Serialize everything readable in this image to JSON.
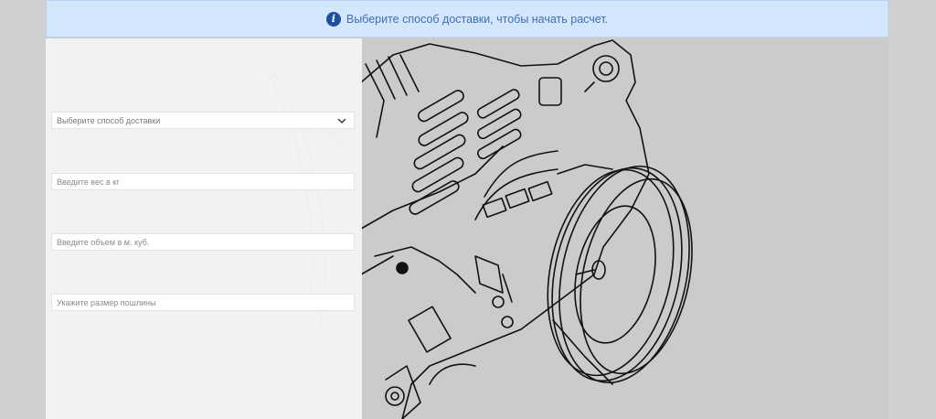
{
  "alert": {
    "icon": "info-icon",
    "icon_glyph": "i",
    "text": "Выберите способ доставки, чтобы начать расчет."
  },
  "form": {
    "delivery_select": {
      "value": "Выберите способ доставки",
      "icon": "chevron-down-icon"
    },
    "weight_input": {
      "placeholder": "Введите вес в кг"
    },
    "volume_input": {
      "placeholder": "Введите объем в м. куб."
    },
    "duty_input": {
      "placeholder": "Укажите размер пошлины"
    }
  },
  "background": {
    "illustration": "alternator-line-drawing"
  }
}
